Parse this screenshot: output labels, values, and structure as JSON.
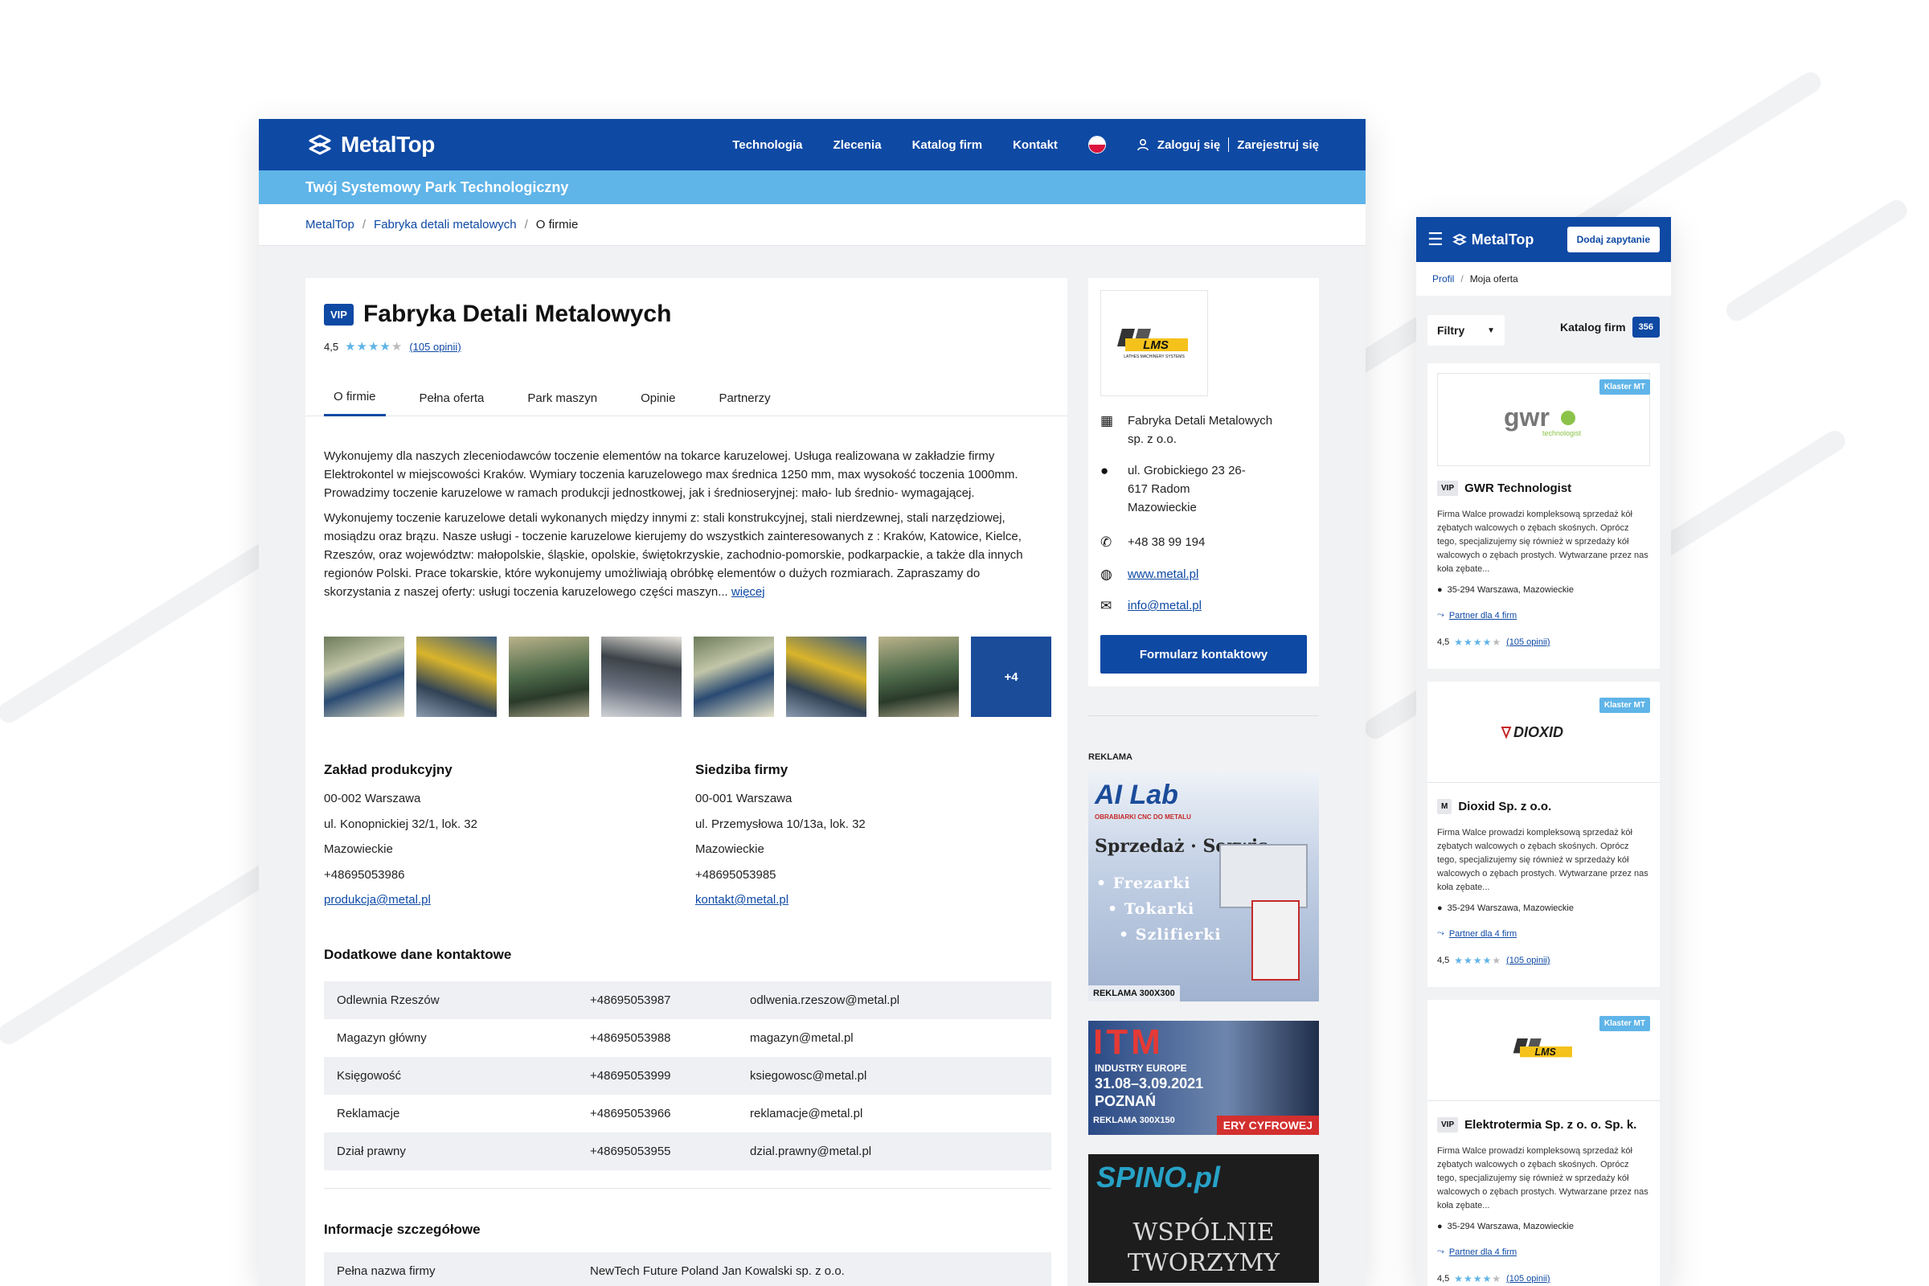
{
  "desktop": {
    "brand": "MetalTop",
    "nav": [
      "Technologia",
      "Zlecenia",
      "Katalog firm",
      "Kontakt"
    ],
    "login": "Zaloguj się",
    "register": "Zarejestruj się",
    "tagline": "Twój Systemowy Park Technologiczny",
    "breadcrumb": [
      "MetalTop",
      "Fabryka detali metalowych",
      "O firmie"
    ],
    "company": {
      "badge": "VIP",
      "name": "Fabryka Detali Metalowych",
      "rating": "4,5",
      "reviews": "(105 opinii)",
      "tabs": [
        "O firmie",
        "Pełna oferta",
        "Park maszyn",
        "Opinie",
        "Partnerzy"
      ],
      "desc1": "Wykonujemy dla naszych zleceniodawców toczenie elementów na tokarce karuzelowej. Usługa realizowana w zakładzie firmy Elektrokontel w miejscowości Kraków. Wymiary toczenia karuzelowego max średnica 1250 mm, max wysokość toczenia 1000mm. Prowadzimy toczenie karuzelowe w ramach produkcji jednostkowej, jak i średnioseryjnej: mało- lub średnio- wymagającej.",
      "desc2": "Wykonujemy toczenie karuzelowe detali wykonanych między innymi z: stali konstrukcyjnej, stali nierdzewnej, stali narzędziowej, mosiądzu oraz brązu. Nasze usługi - toczenie karuzelowe kierujemy do wszystkich zainteresowanych z : Kraków, Katowice, Kielce, Rzeszów, oraz województw: małopolskie, śląskie, opolskie, świętokrzyskie, zachodnio-pomorskie, podkarpackie, a także dla innych regionów Polski. Prace tokarskie, które wykonujemy umożliwiają obróbkę elementów o dużych rozmiarach. Zapraszamy do skorzystania z naszej oferty: usługi toczenia karuzelowego części maszyn...",
      "more": "więcej",
      "gallery_more": "+4"
    },
    "plant": {
      "title": "Zakład produkcyjny",
      "lines": [
        "00-002 Warszawa",
        "ul. Konopnickiej 32/1, lok. 32",
        "Mazowieckie",
        "+48695053986"
      ],
      "email": "produkcja@metal.pl"
    },
    "hq": {
      "title": "Siedziba firmy",
      "lines": [
        "00-001 Warszawa",
        "ul. Przemysłowa 10/13a, lok. 32",
        "Mazowieckie",
        "+48695053985"
      ],
      "email": "kontakt@metal.pl"
    },
    "extra_title": "Dodatkowe dane kontaktowe",
    "extra_rows": [
      [
        "Odlewnia Rzeszów",
        "+48695053987",
        "odlwenia.rzeszow@metal.pl"
      ],
      [
        "Magazyn główny",
        "+48695053988",
        "magazyn@metal.pl"
      ],
      [
        "Księgowość",
        "+48695053999",
        "ksiegowosc@metal.pl"
      ],
      [
        "Reklamacje",
        "+48695053966",
        "reklamacje@metal.pl"
      ],
      [
        "Dział prawny",
        "+48695053955",
        "dzial.prawny@metal.pl"
      ]
    ],
    "details_title": "Informacje szczegółowe",
    "details_rows": [
      [
        "Pełna nazwa firmy",
        "NewTech Future Poland Jan Kowalski sp. z o.o."
      ]
    ],
    "side": {
      "logo_text": "LMS",
      "logo_sub": "LATHES MACHINERY SYSTEMS",
      "company": "Fabryka Detali Metalowych sp. z o.o.",
      "address": "ul. Grobickiego 23 26-617 Radom Mazowieckie",
      "phone": "+48 38 99 194",
      "www": "www.metal.pl",
      "email": "info@metal.pl",
      "button": "Formularz kontaktowy"
    },
    "ads": {
      "label": "REKLAMA",
      "ad1_title": "AI Lab",
      "ad1_sub": "OBRABIARKI CNC DO METALU",
      "ad1_lines": [
        "Sprzedaż · Serwis",
        "• Frezarki",
        "• Tokarki",
        "• Szlifierki"
      ],
      "ad1_tag": "REKLAMA 300X300",
      "ad2_title": "ITM",
      "ad2_lines": [
        "INDUSTRY EUROPE",
        "31.08–3.09.2021",
        "POZNAŃ"
      ],
      "ad2_tag": "REKLAMA 300X150",
      "ad2_strip": "ERY CYFROWEJ",
      "ad3_title": "SPINO.pl",
      "ad3_lines": [
        "Wspólnie",
        "tworzymy"
      ]
    }
  },
  "mobile": {
    "brand": "MetalTop",
    "cta": "Dodaj zapytanie",
    "breadcrumb": [
      "Profil",
      "Moja oferta"
    ],
    "filters": "Filtry",
    "catalog": "Katalog firm",
    "count": "356",
    "cards": [
      {
        "badge": "Klaster MT",
        "tier": "VIP",
        "name": "GWR Technologist",
        "logo": "gwr",
        "desc": "Firma Walce prowadzi kompleksową sprzedaż kół zębatych walcowych o zębach skośnych. Oprócz tego, specjalizujemy się również w sprzedaży kół walcowych o zębach prostych. Wytwarzane przez nas koła zębate...",
        "location": "35-294 Warszawa, Mazowieckie",
        "partner": "Partner dla 4 firm",
        "rating": "4,5",
        "reviews": "(105 opinii)"
      },
      {
        "badge": "Klaster MT",
        "tier": "M",
        "name": "Dioxid Sp. z o.o.",
        "logo": "DIOXID",
        "desc": "Firma Walce prowadzi kompleksową sprzedaż kół zębatych walcowych o zębach skośnych. Oprócz tego, specjalizujemy się również w sprzedaży kół walcowych o zębach prostych. Wytwarzane przez nas koła zębate...",
        "location": "35-294 Warszawa, Mazowieckie",
        "partner": "Partner dla 4 firm",
        "rating": "4,5",
        "reviews": "(105 opinii)"
      },
      {
        "badge": "Klaster MT",
        "tier": "VIP",
        "name": "Elektrotermia Sp. z o. o. Sp. k.",
        "logo": "LMS",
        "desc": "Firma Walce prowadzi kompleksową sprzedaż kół zębatych walcowych o zębach skośnych. Oprócz tego, specjalizujemy się również w sprzedaży kół walcowych o zębach prostych. Wytwarzane przez nas koła zębate...",
        "location": "35-294 Warszawa, Mazowieckie",
        "partner": "Partner dla 4 firm",
        "rating": "4,5",
        "reviews": "(105 opinii)"
      }
    ]
  },
  "colors": {
    "primary": "#0e49a4",
    "accent": "#5fb4e8",
    "page_bg": "#f1f2f4"
  }
}
